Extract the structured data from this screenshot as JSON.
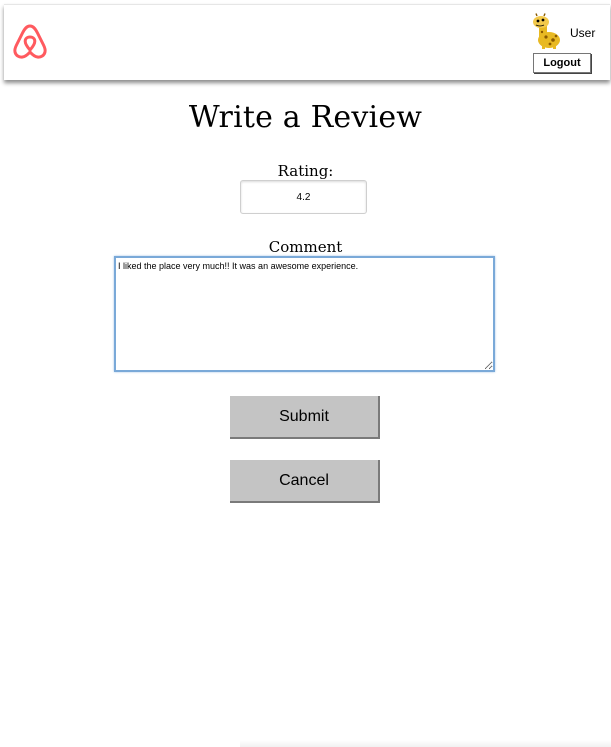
{
  "header": {
    "logo_icon": "airbnb-logo-icon",
    "brand_color": "#ff5a5f",
    "user": {
      "avatar_icon": "giraffe-avatar-icon",
      "name": "User"
    },
    "logout_label": "Logout"
  },
  "form": {
    "title": "Write a Review",
    "rating": {
      "label": "Rating:",
      "value": "4.2"
    },
    "comment": {
      "label": "Comment",
      "value": "I liked the place very much!! It was an awesome experience."
    },
    "submit_label": "Submit",
    "cancel_label": "Cancel"
  }
}
